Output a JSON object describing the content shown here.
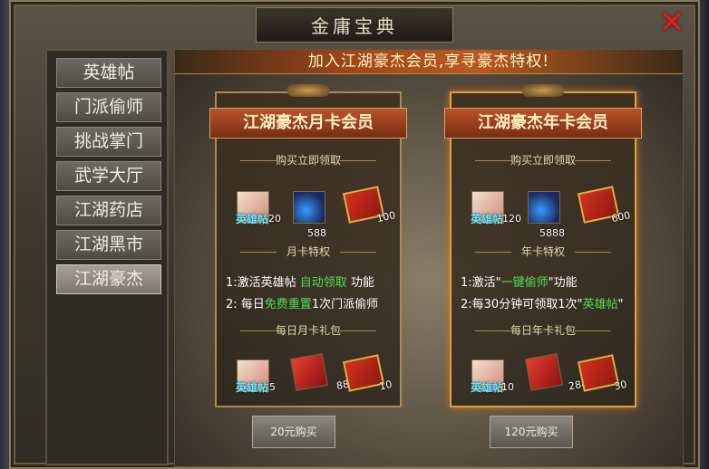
{
  "window": {
    "title": "金庸宝典"
  },
  "close_icon": "✕",
  "sidebar": {
    "items": [
      {
        "label": "英雄帖"
      },
      {
        "label": "门派偷师"
      },
      {
        "label": "挑战掌门"
      },
      {
        "label": "武学大厅"
      },
      {
        "label": "江湖药店"
      },
      {
        "label": "江湖黑市"
      },
      {
        "label": "江湖豪杰"
      }
    ],
    "active": "江湖豪杰"
  },
  "banner": {
    "text": "加入江湖豪杰会员,享寻豪杰特权!"
  },
  "month_card": {
    "title": "江湖豪杰月卡会员",
    "buy_claim": "购买立即领取",
    "claim_items": [
      {
        "icon": "ticket-icon",
        "label": "英雄帖",
        "qty": "20"
      },
      {
        "icon": "feather-icon",
        "qty": "588"
      },
      {
        "icon": "gift-card-icon",
        "qty": "100"
      }
    ],
    "privilege_header": "月卡特权",
    "perk1": {
      "prefix": "1:激活英雄帖 ",
      "highlight": "自动领取",
      "suffix": " 功能"
    },
    "perk2": {
      "prefix": "2: 每日",
      "highlight": "免费重置",
      "suffix": "1次门派偷师"
    },
    "daily_header": "每日月卡礼包",
    "daily_items": [
      {
        "icon": "ticket-icon",
        "label": "英雄帖",
        "qty": "5"
      },
      {
        "icon": "red-book-icon",
        "qty": "88"
      },
      {
        "icon": "gift-card-icon",
        "qty": "10"
      }
    ],
    "buy_label": "20元购买"
  },
  "year_card": {
    "title": "江湖豪杰年卡会员",
    "buy_claim": "购买立即领取",
    "claim_items": [
      {
        "icon": "ticket-icon",
        "label": "英雄帖",
        "qty": "120"
      },
      {
        "icon": "feather-icon",
        "qty": "5888"
      },
      {
        "icon": "gift-card-icon",
        "qty": "600"
      }
    ],
    "privilege_header": "年卡特权",
    "perk1": {
      "prefix": "1:激活\"",
      "highlight": "一键偷师",
      "suffix": "\"功能"
    },
    "perk2": {
      "prefix": "2:每30分钟可领取1次\"",
      "highlight": "英雄帖",
      "suffix": "\""
    },
    "daily_header": "每日年卡礼包",
    "daily_items": [
      {
        "icon": "ticket-icon",
        "label": "英雄帖",
        "qty": "10"
      },
      {
        "icon": "red-book-icon",
        "qty": "288"
      },
      {
        "icon": "gift-card-icon",
        "qty": "30"
      }
    ],
    "buy_label": "120元购买"
  },
  "colors": {
    "highlight_green": "#4ee04e",
    "item_label_cyan": "#6ae8ff",
    "close_red": "#e02020"
  }
}
